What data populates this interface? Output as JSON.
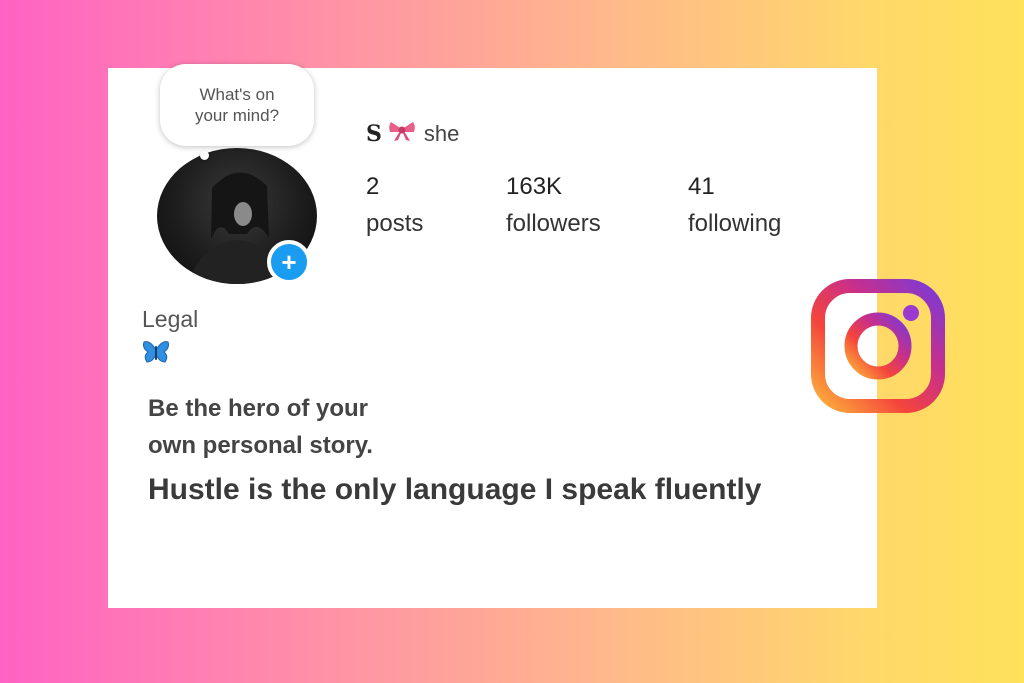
{
  "profile": {
    "bubble_text": "What's on your mind?",
    "username_initial": "S",
    "pronouns": "she",
    "add_story_symbol": "+",
    "stats": {
      "posts": {
        "value": "2",
        "label": "posts"
      },
      "followers": {
        "value": "163K",
        "label": "followers"
      },
      "following": {
        "value": "41",
        "label": "following"
      }
    },
    "bio": {
      "name": "Legal",
      "emoji_icon": "butterfly-icon",
      "line1": "Be the hero of your",
      "line2": "own personal story.",
      "line3": "Hustle is the only language I speak fluently"
    }
  },
  "colors": {
    "background_gradient": [
      "#ff62c4",
      "#ffb98a",
      "#ffe15a"
    ],
    "add_story_blue": "#1a9cf0",
    "butterfly_blue": "#2f8fe0",
    "bow_pink": "#e8608a"
  },
  "icons": [
    "bow-icon",
    "add-story-icon",
    "butterfly-icon",
    "instagram-logo-icon"
  ]
}
